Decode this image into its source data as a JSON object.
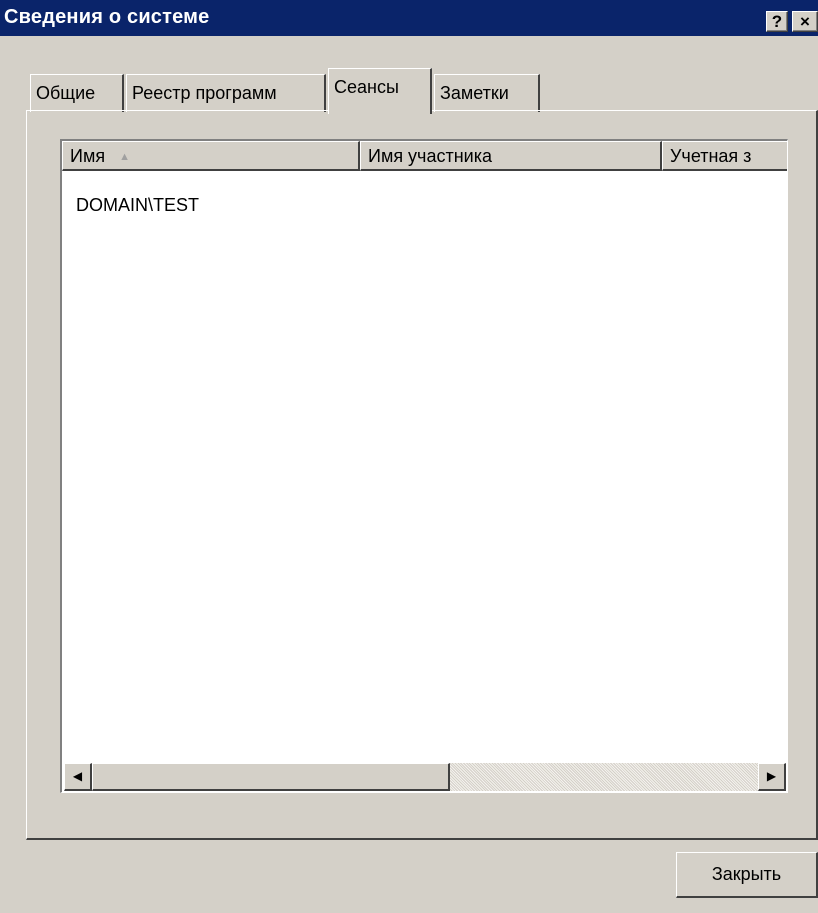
{
  "window": {
    "title": "Сведения о системе",
    "help_label": "?",
    "close_label": "×"
  },
  "tabs": [
    {
      "label": "Общие"
    },
    {
      "label": "Реестр программ"
    },
    {
      "label": "Сеансы",
      "active": true
    },
    {
      "label": "Заметки"
    }
  ],
  "listview": {
    "columns": [
      {
        "label": "Имя",
        "sorted": "ascending"
      },
      {
        "label": "Имя участника"
      },
      {
        "label": "Учетная з"
      }
    ],
    "rows": [
      {
        "name": "DOMAIN\\TEST"
      }
    ],
    "scroll_left_glyph": "◀",
    "scroll_right_glyph": "▶",
    "sort_glyph": "▲"
  },
  "buttons": {
    "close_label": "Закрыть"
  }
}
